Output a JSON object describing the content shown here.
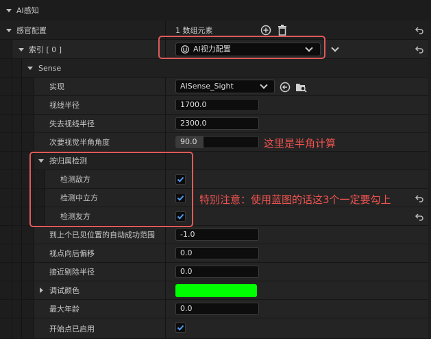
{
  "header": {
    "title": "AI感知"
  },
  "sense_config": {
    "label": "感官配置",
    "value": "1 数组元素",
    "index": {
      "label": "索引 [ 0 ]",
      "selected": "AI视力配置"
    },
    "sense_group": {
      "label": "Sense"
    },
    "props": {
      "implementation": {
        "label": "实现",
        "value": "AISense_Sight"
      },
      "sight_radius": {
        "label": "视线半径",
        "value": "1700.0"
      },
      "lose_sight_radius": {
        "label": "失去视线半径",
        "value": "2300.0"
      },
      "peripheral_angle": {
        "label": "次要视觉半角角度",
        "value": "90.0",
        "fill": 0.33
      }
    },
    "affiliation": {
      "label": "按归属检测",
      "enemies": {
        "label": "检测敌方",
        "checked": true
      },
      "neutrals": {
        "label": "检测中立方",
        "checked": true
      },
      "friendlies": {
        "label": "检测友方",
        "checked": true
      }
    },
    "more": {
      "auto_success_range": {
        "label": "到上个已见位置的自动成功范围",
        "value": "-1.0"
      },
      "point_of_view_backward_offset": {
        "label": "视点向后偏移",
        "value": "0.0"
      },
      "near_clipping_radius": {
        "label": "接近剔除半径",
        "value": "0.0"
      },
      "debug_color": {
        "label": "调试颜色",
        "color": "#00ff00"
      },
      "max_age": {
        "label": "最大年龄",
        "value": "0.0"
      },
      "starts_enabled": {
        "label": "开始点已启用",
        "checked": true
      }
    }
  },
  "annotations": {
    "half_angle_note": "这里是半角计算",
    "blueprint_note": "特别注意：使用蓝图的话这3个一定要勾上"
  },
  "colors": {
    "highlight": "#e05a5a",
    "annotation_text": "#ef5350",
    "checkbox_check": "#4f9cf7",
    "debug_green": "#00ff00"
  }
}
